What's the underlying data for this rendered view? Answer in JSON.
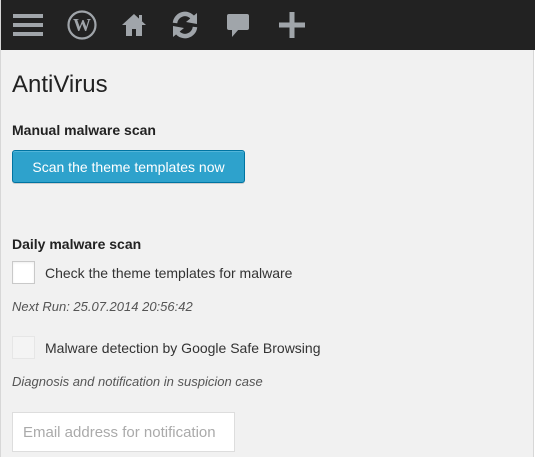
{
  "adminbar": {
    "background": "#222222",
    "icon_color": "#a0a5aa",
    "icons": [
      "menu-icon",
      "wordpress-icon",
      "home-icon",
      "updates-icon",
      "comments-icon",
      "add-new-icon"
    ]
  },
  "page": {
    "title": "AntiVirus"
  },
  "manual_scan": {
    "heading": "Manual malware scan",
    "button_label": "Scan the theme templates now",
    "button_color": "#2ea2cc"
  },
  "daily_scan": {
    "heading": "Daily malware scan",
    "check_templates_label": "Check the theme templates for malware",
    "check_templates_checked": false,
    "next_run": "Next Run: 25.07.2014 20:56:42",
    "safe_browsing_label": "Malware detection by Google Safe Browsing",
    "safe_browsing_checked": false,
    "safe_browsing_disabled": true,
    "diagnosis_note": "Diagnosis and notification in suspicion case",
    "email_placeholder": "Email address for notification",
    "email_value": ""
  }
}
